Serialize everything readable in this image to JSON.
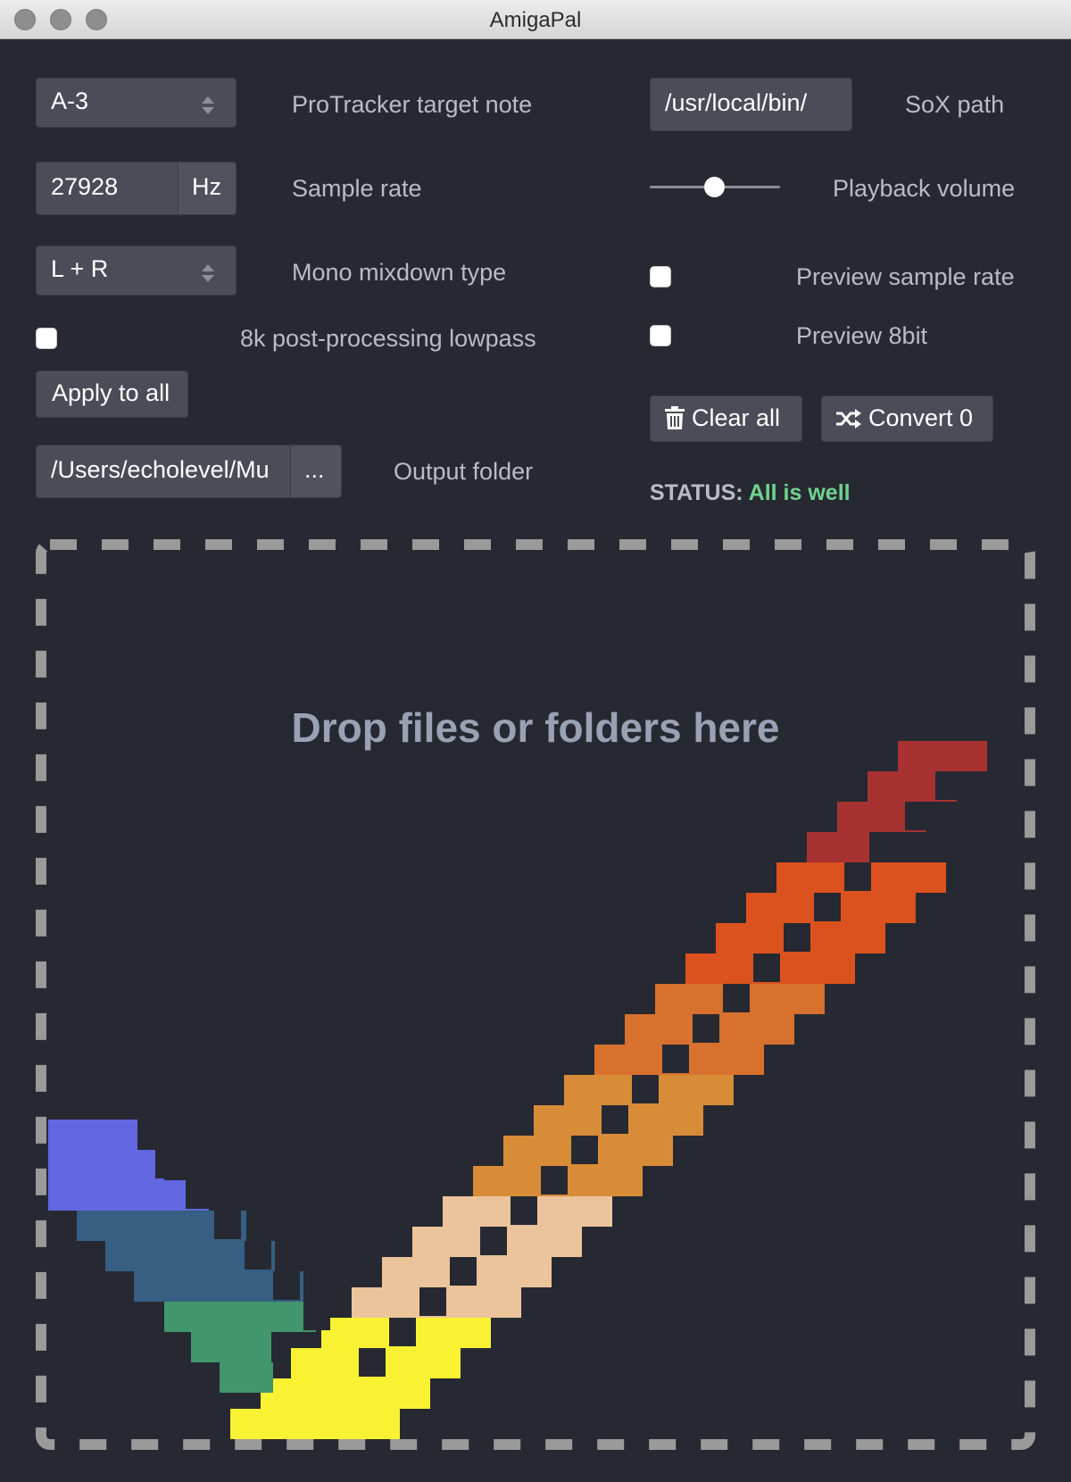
{
  "window": {
    "title": "AmigaPal"
  },
  "left": {
    "note": {
      "value": "A-3",
      "label": "ProTracker target note"
    },
    "sample_rate": {
      "value": "27928",
      "unit": "Hz",
      "label": "Sample rate"
    },
    "mixdown": {
      "value": "L + R",
      "label": "Mono mixdown type"
    },
    "lowpass": {
      "label": "8k post-processing lowpass",
      "checked": false
    },
    "apply_all": {
      "label": "Apply to all"
    },
    "output": {
      "value": "/Users/echolevel/Mu",
      "browse_label": "...",
      "label": "Output folder"
    }
  },
  "right": {
    "sox": {
      "value": "/usr/local/bin/",
      "label": "SoX path"
    },
    "volume": {
      "label": "Playback volume",
      "level": 0.5
    },
    "preview_rate": {
      "label": "Preview sample rate",
      "checked": false
    },
    "preview_8bit": {
      "label": "Preview 8bit",
      "checked": false
    },
    "clear_all": {
      "label": "Clear all"
    },
    "convert": {
      "label": "Convert 0"
    },
    "status": {
      "key": "STATUS:",
      "value": "All is well"
    }
  },
  "dropzone": {
    "text": "Drop files or folders here"
  },
  "colors": {
    "background": "#272932",
    "control": "#4a4d57",
    "status_ok": "#6fd38f",
    "dash": "#9a9a9a",
    "check_red": "#a83232",
    "check_orange_red": "#dc521e",
    "check_orange": "#d8712d",
    "check_amber": "#d98c38",
    "check_peach": "#ecc49b",
    "check_yellow": "#f9f233",
    "check_green": "#41966b",
    "check_teal_blue": "#375e83",
    "check_violet": "#6167e0"
  },
  "icons": [
    "trash-icon",
    "shuffle-icon",
    "select-arrows-icon"
  ]
}
